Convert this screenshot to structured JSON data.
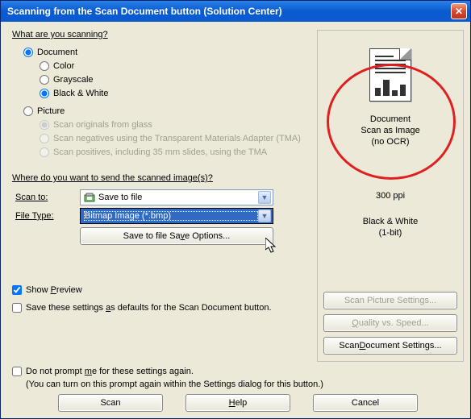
{
  "title": "Scanning from the Scan Document button (Solution Center)",
  "q1": "What are you scanning?",
  "opt": {
    "document": "Document",
    "color": "Color",
    "grayscale": "Grayscale",
    "bw": "Black & White",
    "picture": "Picture",
    "p1": "Scan originals from glass",
    "p2": "Scan negatives using the Transparent Materials Adapter (TMA)",
    "p3": "Scan positives, including 35 mm slides, using the TMA"
  },
  "q2": "Where do you want to send the scanned image(s)?",
  "fields": {
    "scan_to_label_pre": "Scan ",
    "scan_to_label_ul": "t",
    "scan_to_label_post": "o:",
    "scan_to_value": "Save to file",
    "file_type_label_pre": "File T",
    "file_type_label_ul": "y",
    "file_type_label_post": "pe:",
    "file_type_value": "Bitmap Image (*.bmp)",
    "save_opts_pre": "Save to file Sa",
    "save_opts_ul": "v",
    "save_opts_post": "e Options..."
  },
  "checks": {
    "show_preview_pre": "Show ",
    "show_preview_ul": "P",
    "show_preview_post": "review",
    "save_defaults_pre": "Save these settings ",
    "save_defaults_ul": "a",
    "save_defaults_post": "s defaults for the Scan Document button.",
    "no_prompt_pre": "Do not prompt ",
    "no_prompt_ul": "m",
    "no_prompt_post": "e for these settings again.",
    "no_prompt_note": "(You can turn on this prompt again within the Settings dialog for this button.)"
  },
  "right": {
    "l1": "Document",
    "l2": "Scan as Image",
    "l3": "(no OCR)",
    "ppi": "300 ppi",
    "mode1": "Black & White",
    "mode2": "(1-bit)",
    "btn_pic": "Scan Picture Settings...",
    "btn_qual_pre": "",
    "btn_qual_ul": "Q",
    "btn_qual_post": "uality vs. Speed...",
    "btn_doc_pre": "Scan ",
    "btn_doc_ul": "D",
    "btn_doc_post": "ocument Settings..."
  },
  "buttons": {
    "scan": "Scan",
    "help_ul": "H",
    "help_post": "elp",
    "cancel": "Cancel"
  }
}
